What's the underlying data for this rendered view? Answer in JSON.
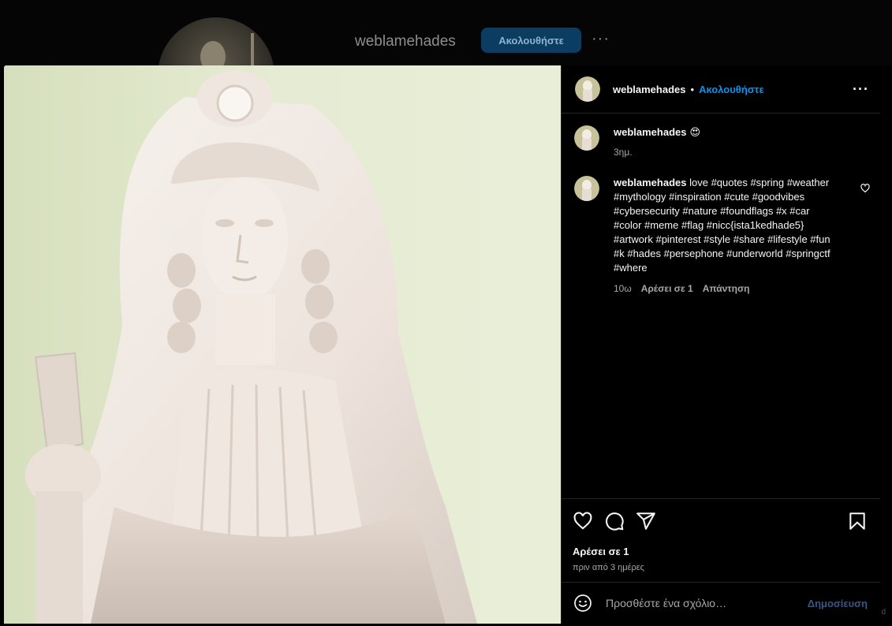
{
  "background": {
    "username": "weblamehades",
    "follow_label": "Ακολουθήστε",
    "more_label": "···"
  },
  "post": {
    "image_icon": "statue-photo",
    "header": {
      "username": "weblamehades",
      "separator": "•",
      "follow_label": "Ακολουθήστε",
      "more_label": "···"
    },
    "caption": {
      "username": "weblamehades",
      "emoji": "😍",
      "time": "3ημ."
    },
    "comment": {
      "username": "weblamehades",
      "text": " love #quotes #spring #weather #mythology #inspiration #cute #goodvibes #cybersecurity #nature #foundflags #x #car #color #meme #flag #nicc{ista1kedhade5} #artwork #pinterest #style #share #lifestyle #fun #k #hades #persephone #underworld #springctf #where",
      "time": "10ω",
      "likes": "Αρέσει σε 1",
      "reply": "Απάντηση"
    },
    "actions": {
      "likes": "Αρέσει σε 1",
      "date": "πριν από 3 ημέρες"
    },
    "add_comment": {
      "placeholder": "Προσθέστε ένα σχόλιο…",
      "post_label": "Δημοσίευση"
    }
  },
  "corner_mark": "d",
  "colors": {
    "accent": "#0095f6",
    "follow_button_dim": "#0b3d63",
    "post_button_dim": "#35578a",
    "photo_background": "#e3ead0"
  }
}
